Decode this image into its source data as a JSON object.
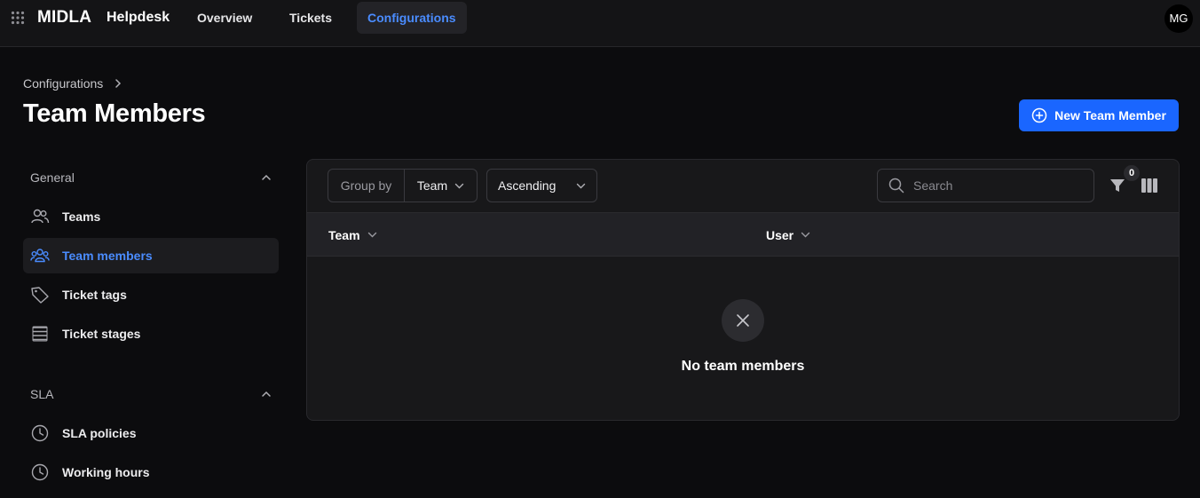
{
  "topbar": {
    "brand": "MIDLA",
    "app_name": "Helpdesk",
    "tabs": [
      {
        "label": "Overview"
      },
      {
        "label": "Tickets"
      },
      {
        "label": "Configurations",
        "active": true
      }
    ],
    "avatar_initials": "MG"
  },
  "header": {
    "breadcrumb": [
      "Configurations"
    ],
    "title": "Team Members",
    "new_button_label": "New Team Member"
  },
  "sidebar": {
    "sections": [
      {
        "title": "General",
        "items": [
          {
            "label": "Teams",
            "icon": "users-icon"
          },
          {
            "label": "Team members",
            "icon": "team-members-icon",
            "active": true
          },
          {
            "label": "Ticket tags",
            "icon": "tag-icon"
          },
          {
            "label": "Ticket stages",
            "icon": "stages-icon"
          }
        ]
      },
      {
        "title": "SLA",
        "items": [
          {
            "label": "SLA policies",
            "icon": "clock-icon"
          },
          {
            "label": "Working hours",
            "icon": "clock-icon"
          }
        ]
      }
    ]
  },
  "toolbar": {
    "group_by_label": "Group by",
    "group_by_value": "Team",
    "sort_value": "Ascending",
    "search_placeholder": "Search",
    "filter_count": "0"
  },
  "table": {
    "columns": [
      "Team",
      "User"
    ]
  },
  "empty_state": {
    "message": "No team members"
  },
  "colors": {
    "accent": "#1a66ff",
    "active_text": "#4a8cff",
    "background": "#0c0c0e"
  }
}
